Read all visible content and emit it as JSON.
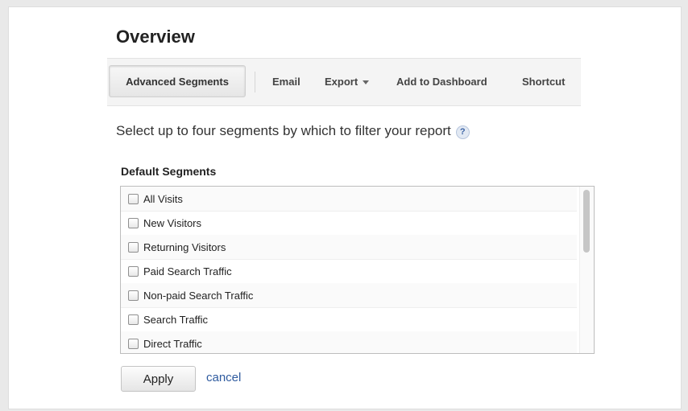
{
  "page": {
    "title": "Overview"
  },
  "toolbar": {
    "advanced_segments": "Advanced Segments",
    "email": "Email",
    "export": "Export",
    "add_to_dashboard": "Add to Dashboard",
    "shortcut": "Shortcut"
  },
  "instruction": {
    "text": "Select up to four segments by which to filter your report",
    "help_icon_glyph": "?"
  },
  "segments": {
    "heading": "Default Segments",
    "items": [
      {
        "label": "All Visits",
        "checked": false
      },
      {
        "label": "New Visitors",
        "checked": false
      },
      {
        "label": "Returning Visitors",
        "checked": false
      },
      {
        "label": "Paid Search Traffic",
        "checked": false
      },
      {
        "label": "Non-paid Search Traffic",
        "checked": false
      },
      {
        "label": "Search Traffic",
        "checked": false
      },
      {
        "label": "Direct Traffic",
        "checked": false
      }
    ]
  },
  "actions": {
    "apply": "Apply",
    "cancel": "cancel"
  },
  "colors": {
    "link": "#2f5b9f",
    "help_icon": "#3b62a4"
  }
}
